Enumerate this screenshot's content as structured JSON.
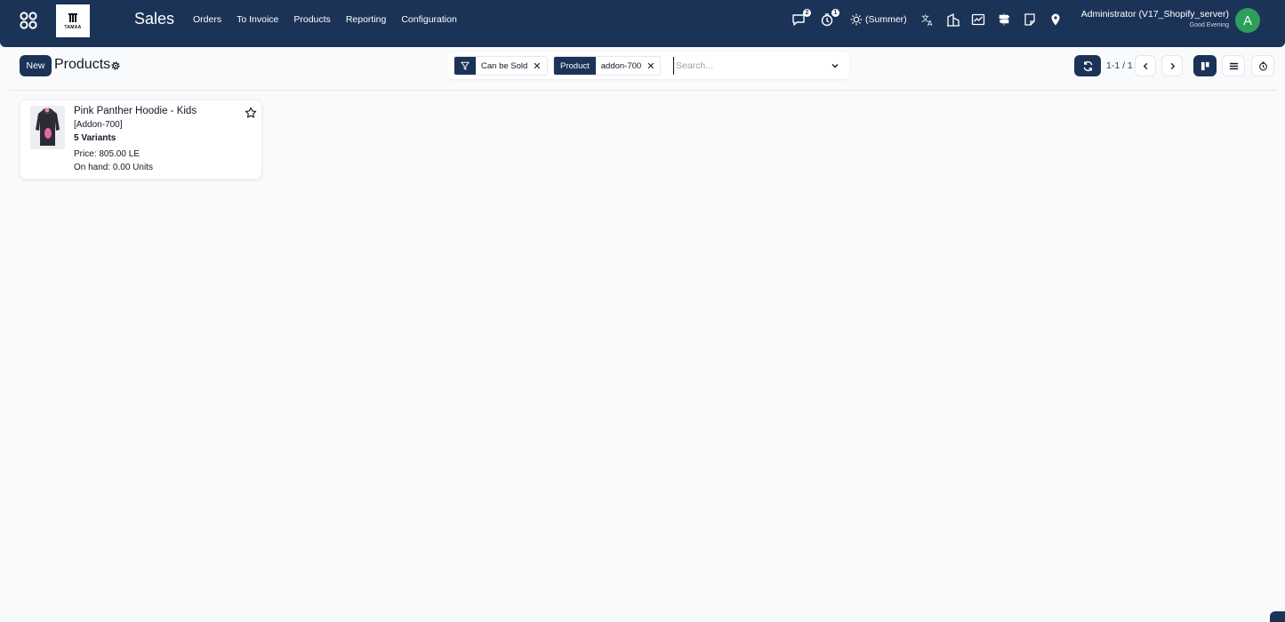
{
  "navbar": {
    "logo_text": "TAMAA",
    "app_title": "Sales",
    "menu": [
      "Orders",
      "To Invoice",
      "Products",
      "Reporting",
      "Configuration"
    ],
    "messages_count": "2",
    "activities_count": "1",
    "theme_label": "(Summer)",
    "user_name": "Administrator (V17_Shopify_server)",
    "user_greeting": "Good Evening",
    "avatar_letter": "A",
    "brand_color": "#1c3358",
    "avatar_color": "#2e9e5b"
  },
  "control": {
    "new_label": "New",
    "page_title": "Products",
    "filter_facet": "Can be Sold",
    "group_facet_label": "Product",
    "group_facet_value": "addon-700",
    "search_placeholder": "Search...",
    "pager": "1-1 / 1"
  },
  "card": {
    "title": "Pink Panther Hoodie - Kids",
    "reference": "[Addon-700]",
    "variants": "5 Variants",
    "price": "Price: 805.00 LE",
    "on_hand": "On hand: 0.00 Units"
  }
}
